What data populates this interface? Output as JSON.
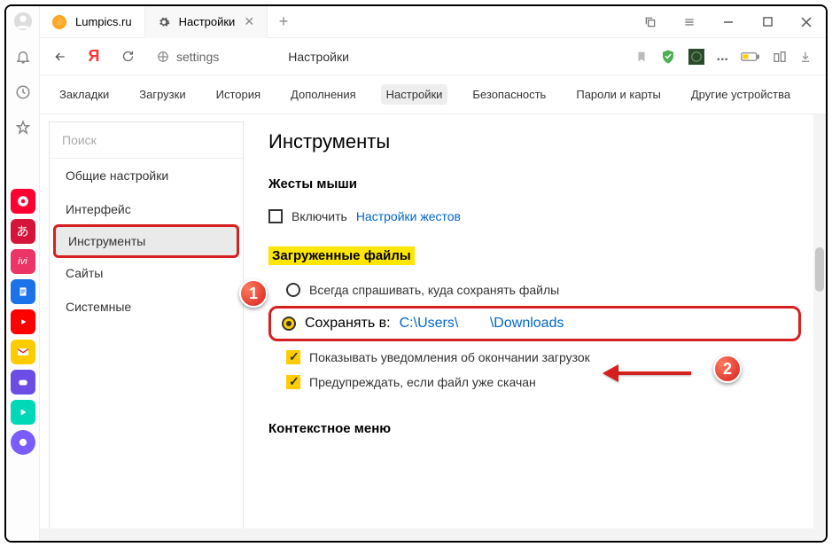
{
  "tabs": [
    {
      "label": "Lumpics.ru",
      "favicon_color": "#ff9800"
    },
    {
      "label": "Настройки",
      "favicon": "gear"
    }
  ],
  "toolbar": {
    "addr_text": "settings",
    "page_title": "Настройки"
  },
  "subnav": {
    "items": [
      "Закладки",
      "Загрузки",
      "История",
      "Дополнения",
      "Настройки",
      "Безопасность",
      "Пароли и карты",
      "Другие устройства"
    ],
    "active": "Настройки"
  },
  "settings_nav": {
    "search_placeholder": "Поиск",
    "items": [
      "Общие настройки",
      "Интерфейс",
      "Инструменты",
      "Сайты",
      "Системные"
    ],
    "selected": "Инструменты"
  },
  "body": {
    "h1": "Инструменты",
    "mouse": {
      "h2": "Жесты мыши",
      "enable": "Включить",
      "settings_link": "Настройки жестов"
    },
    "downloads": {
      "h2": "Загруженные файлы",
      "always_ask": "Всегда спрашивать, куда сохранять файлы",
      "save_to": "Сохранять в:",
      "path": "C:\\Users\\        \\Downloads",
      "show_notif": "Показывать уведомления об окончании загрузок",
      "warn_dup": "Предупреждать, если файл уже скачан"
    },
    "context": {
      "h2": "Контекстное меню"
    }
  },
  "markers": {
    "m1": "1",
    "m2": "2"
  }
}
